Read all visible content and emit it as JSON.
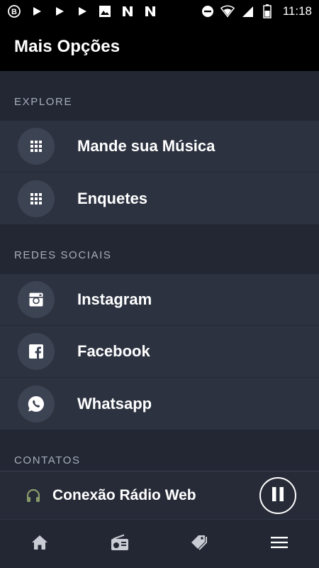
{
  "status_bar": {
    "time": "11:18",
    "left_icons": [
      "b-notification-icon",
      "play-icon",
      "play-icon",
      "play-icon",
      "image-icon",
      "n-app-icon",
      "n-app-icon"
    ],
    "right_icons": [
      "do-not-disturb-icon",
      "wifi-icon",
      "signal-icon",
      "battery-icon"
    ]
  },
  "app_bar": {
    "title": "Mais Opções"
  },
  "sections": [
    {
      "header": "EXPLORE",
      "items": [
        {
          "label": "Mande sua Música",
          "icon": "grid-icon"
        },
        {
          "label": "Enquetes",
          "icon": "grid-icon"
        }
      ]
    },
    {
      "header": "REDES SOCIAIS",
      "items": [
        {
          "label": "Instagram",
          "icon": "instagram-icon"
        },
        {
          "label": "Facebook",
          "icon": "facebook-icon"
        },
        {
          "label": "Whatsapp",
          "icon": "whatsapp-icon"
        }
      ]
    },
    {
      "header": "CONTATOS",
      "items": []
    }
  ],
  "player": {
    "station": "Conexão Rádio Web",
    "state_icon": "pause-icon"
  },
  "bottom_nav": [
    {
      "icon": "home-icon"
    },
    {
      "icon": "radio-icon"
    },
    {
      "icon": "tag-icon"
    },
    {
      "icon": "menu-icon"
    }
  ],
  "colors": {
    "background": "#222733",
    "item_background": "#2c3240",
    "icon_circle": "#3c4352",
    "header_text": "#a8aebb",
    "headphones": "#8a9a6a"
  }
}
